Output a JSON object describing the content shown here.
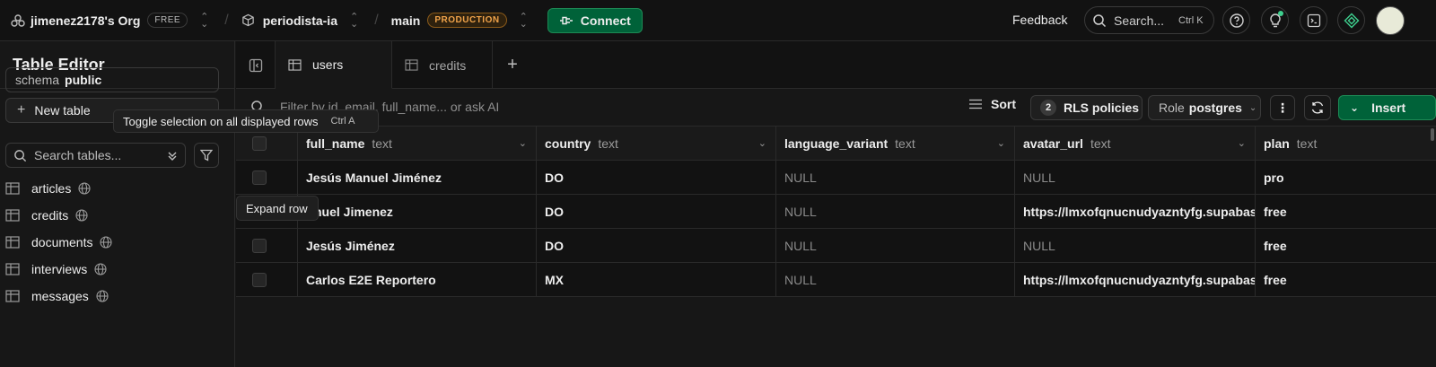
{
  "topbar": {
    "org": "jimenez2178's Org",
    "org_badge": "FREE",
    "project": "periodista-ia",
    "branch": "main",
    "branch_badge": "PRODUCTION",
    "connect_label": "Connect",
    "feedback_label": "Feedback",
    "search_label": "Search...",
    "search_kbd": "Ctrl K"
  },
  "left": {
    "title": "Table Editor",
    "schema_label": "schema",
    "schema_value": "public",
    "new_table_label": "New table",
    "search_placeholder": "Search tables...",
    "tables": [
      {
        "name": "articles"
      },
      {
        "name": "credits"
      },
      {
        "name": "documents"
      },
      {
        "name": "interviews"
      },
      {
        "name": "messages"
      }
    ]
  },
  "tabs": [
    {
      "label": "users",
      "active": true
    },
    {
      "label": "credits",
      "active": false
    }
  ],
  "toolbar": {
    "filter_placeholder": "Filter by id, email, full_name... or ask AI",
    "sort_label": "Sort",
    "rls_count": "2",
    "rls_label": "RLS policies",
    "role_label": "Role",
    "role_value": "postgres",
    "insert_label": "Insert"
  },
  "tooltips": {
    "toggle_selection": "Toggle selection on all displayed rows",
    "toggle_kbd": "Ctrl A",
    "expand_row": "Expand row"
  },
  "grid": {
    "columns": [
      {
        "name": "full_name",
        "type": "text"
      },
      {
        "name": "country",
        "type": "text"
      },
      {
        "name": "language_variant",
        "type": "text"
      },
      {
        "name": "avatar_url",
        "type": "text"
      },
      {
        "name": "plan",
        "type": "text"
      }
    ],
    "rows": [
      [
        "Jesús Manuel Jiménez",
        "DO",
        "NULL",
        "NULL",
        "pro"
      ],
      [
        "nuel Jimenez",
        "DO",
        "NULL",
        "https://lmxofqnucnudyazntyfg.supabase",
        "free"
      ],
      [
        "Jesús Jiménez",
        "DO",
        "NULL",
        "NULL",
        "free"
      ],
      [
        "Carlos E2E Reportero",
        "MX",
        "NULL",
        "https://lmxofqnucnudyazntyfg.supabase",
        "free"
      ]
    ]
  },
  "colors": {
    "accent_green": "#006239",
    "production_orange": "#f0a34a",
    "background": "#171717"
  }
}
